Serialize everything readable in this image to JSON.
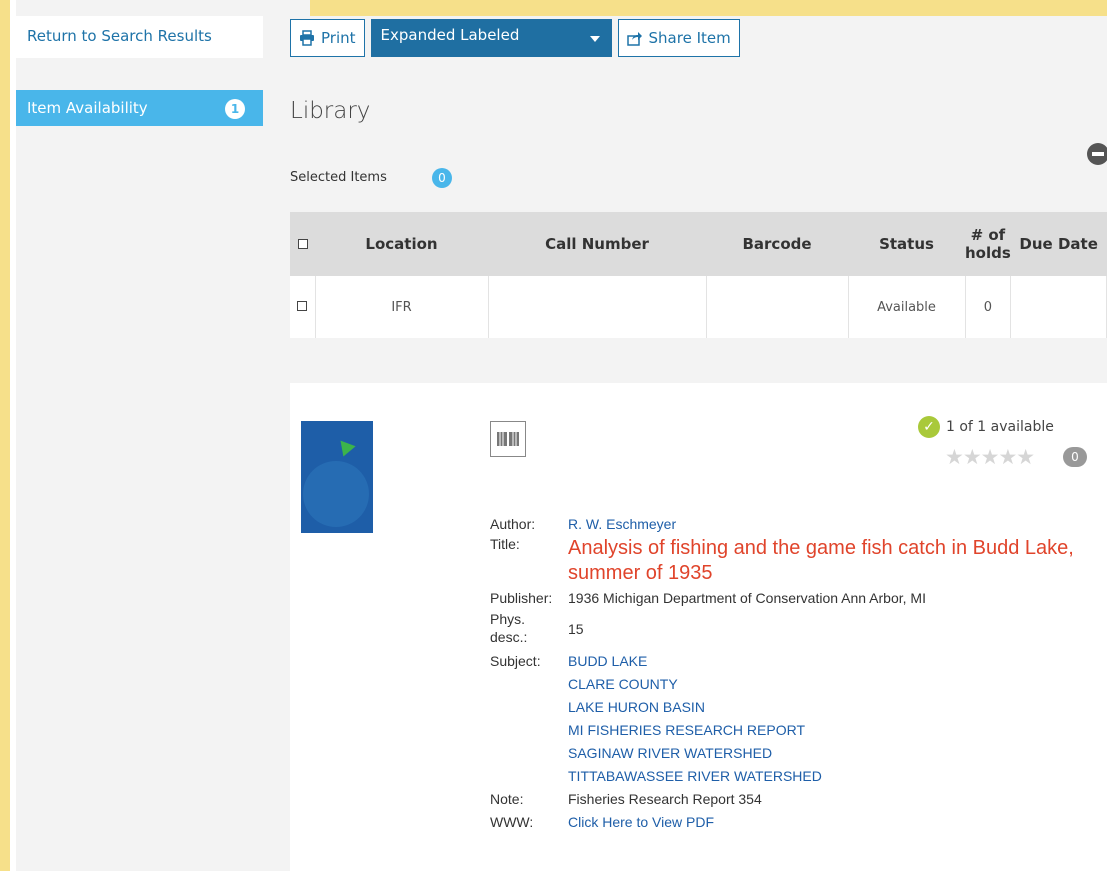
{
  "sidebar": {
    "return_label": "Return to Search Results",
    "availability_label": "Item Availability",
    "availability_count": "1"
  },
  "toolbar": {
    "print_label": "Print",
    "view_selected": "Expanded Labeled",
    "share_label": "Share Item"
  },
  "library": {
    "title": "Library",
    "selected_label": "Selected Items",
    "selected_count": "0"
  },
  "table": {
    "headers": [
      "Location",
      "Call Number",
      "Barcode",
      "Status",
      "# of holds",
      "Due Date"
    ],
    "rows": [
      {
        "location": "IFR",
        "call_number": "",
        "barcode": "",
        "status": "Available",
        "holds": "0",
        "due_date": ""
      }
    ]
  },
  "record": {
    "availability": "1 of 1 available",
    "review_count": "0",
    "stars": "★★★★★",
    "labels": {
      "author": "Author:",
      "title": "Title:",
      "publisher": "Publisher:",
      "phys": "Phys. desc.:",
      "subject": "Subject:",
      "note": "Note:",
      "www": "WWW:"
    },
    "author": "R. W. Eschmeyer",
    "title": "Analysis of fishing and the game fish catch in Budd Lake, summer of 1935",
    "publisher": "1936 Michigan Department of Conservation Ann Arbor, MI",
    "phys_desc": "15",
    "subjects": [
      "BUDD LAKE",
      "CLARE COUNTY",
      "LAKE HURON BASIN",
      "MI FISHERIES RESEARCH REPORT",
      "SAGINAW RIVER WATERSHED",
      "TITTABAWASSEE RIVER WATERSHED"
    ],
    "note": "Fisheries Research Report 354",
    "www": "Click Here to View PDF"
  },
  "colors": {
    "accent": "#1e73a8",
    "tab_active": "#49b6ea",
    "title_red": "#e0442b",
    "available_green": "#7ab648",
    "frame_yellow": "#f6e08a"
  }
}
